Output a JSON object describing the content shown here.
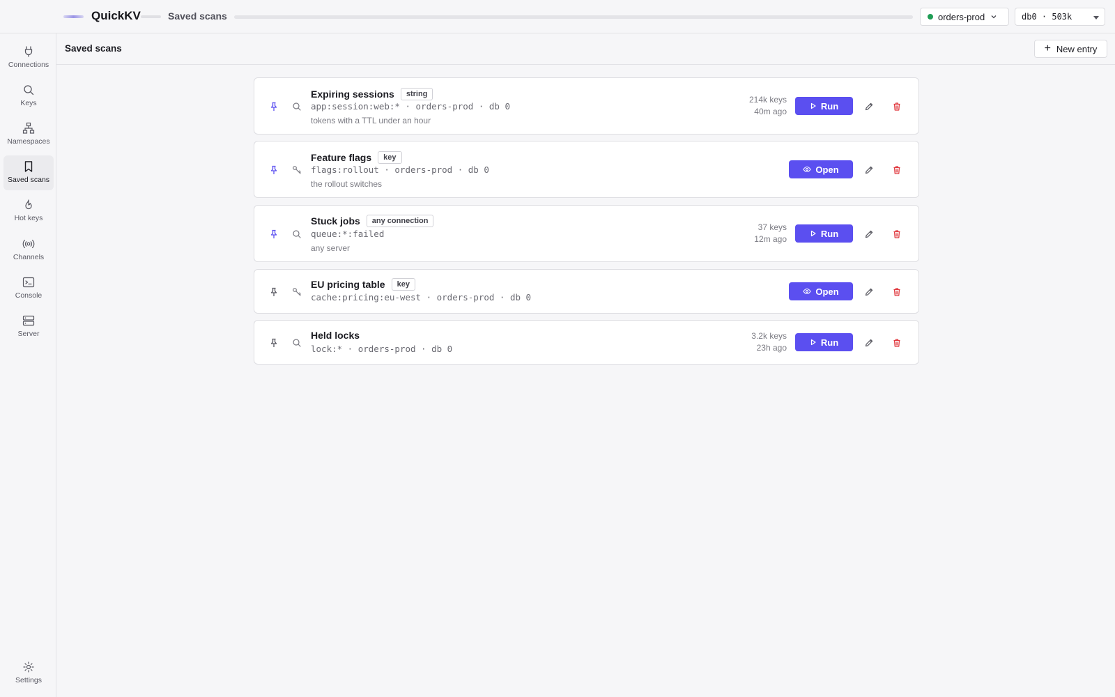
{
  "topbar": {
    "app_name": "QuickKV",
    "breadcrumb": "Saved scans",
    "connection": {
      "name": "orders-prod",
      "status_color": "#1f9d55"
    },
    "database": "db0 · 503k"
  },
  "sidebar": {
    "items": [
      {
        "label": "Connections",
        "icon": "plug-icon"
      },
      {
        "label": "Keys",
        "icon": "search-icon"
      },
      {
        "label": "Namespaces",
        "icon": "hierarchy-icon"
      },
      {
        "label": "Saved scans",
        "icon": "bookmark-icon",
        "active": true
      },
      {
        "label": "Hot keys",
        "icon": "flame-icon"
      },
      {
        "label": "Channels",
        "icon": "broadcast-icon"
      },
      {
        "label": "Console",
        "icon": "terminal-icon"
      },
      {
        "label": "Server",
        "icon": "server-icon"
      }
    ],
    "settings_label": "Settings"
  },
  "page": {
    "title": "Saved scans",
    "new_entry_label": "New entry"
  },
  "scans": [
    {
      "title": "Expiring sessions",
      "badge": "string",
      "pattern": "app:session:web:* · orders-prod · db 0",
      "note": "tokens with a TTL under an hour",
      "keys": "214k keys",
      "age": "40m ago",
      "action": "Run",
      "kind": "search-icon"
    },
    {
      "title": "Feature flags",
      "badge": "key",
      "pattern": "flags:rollout · orders-prod · db 0",
      "note": "the rollout switches",
      "keys": "",
      "age": "",
      "action": "Open",
      "kind": "key-icon"
    },
    {
      "title": "Stuck jobs",
      "badge": "any connection",
      "pattern": "queue:*:failed",
      "note": "any server",
      "keys": "37 keys",
      "age": "12m ago",
      "action": "Run",
      "kind": "search-icon"
    },
    {
      "title": "EU pricing table",
      "badge": "key",
      "pattern": "cache:pricing:eu-west · orders-prod · db 0",
      "note": "",
      "keys": "",
      "age": "",
      "action": "Open",
      "kind": "key-icon"
    },
    {
      "title": "Held locks",
      "badge": "",
      "pattern": "lock:* · orders-prod · db 0",
      "note": "",
      "keys": "3.2k keys",
      "age": "23h ago",
      "action": "Run",
      "kind": "search-icon"
    }
  ],
  "colors": {
    "accent": "#5b4ff0",
    "danger": "#e0383e",
    "pin": "#5b4ff0"
  }
}
